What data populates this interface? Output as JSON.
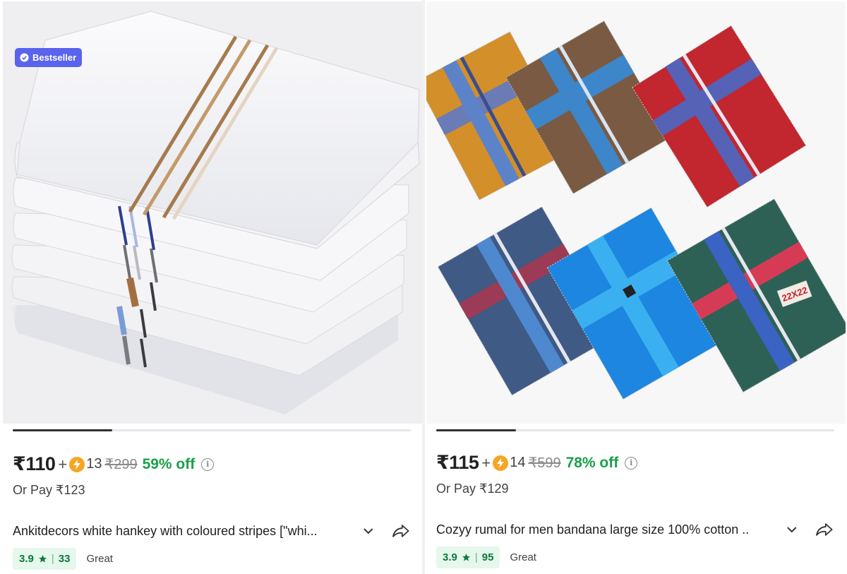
{
  "products": [
    {
      "badge": "Bestseller",
      "price": "₹110",
      "plus": "+",
      "coins": "13",
      "mrp": "₹299",
      "discount": "59% off",
      "or_pay": "Or Pay ₹123",
      "title": "Ankitdecors white hankey with coloured stripes [\"whi...",
      "rating": "3.9",
      "rating_count": "33",
      "rating_label": "Great",
      "image_progress": 0.25
    },
    {
      "price": "₹115",
      "plus": "+",
      "coins": "14",
      "mrp": "₹599",
      "discount": "78% off",
      "or_pay": "Or Pay ₹129",
      "title": "Cozyy rumal for men bandana large size 100% cotton ..",
      "rating": "3.9",
      "rating_count": "95",
      "rating_label": "Great",
      "image_progress": 0.2,
      "image_tag": "22X22"
    }
  ],
  "icons": {
    "badge": "verified-check-icon",
    "coin": "lightning-coin-icon",
    "info": "info-icon",
    "expand": "chevron-down-icon",
    "share": "share-arrow-icon",
    "star": "star-icon"
  },
  "colors": {
    "badge": "#5a63ee",
    "discount": "#1aa04a",
    "rating_bg": "#e6f7ec",
    "rating_text": "#0d7a3e",
    "coin": "#f6a623"
  }
}
